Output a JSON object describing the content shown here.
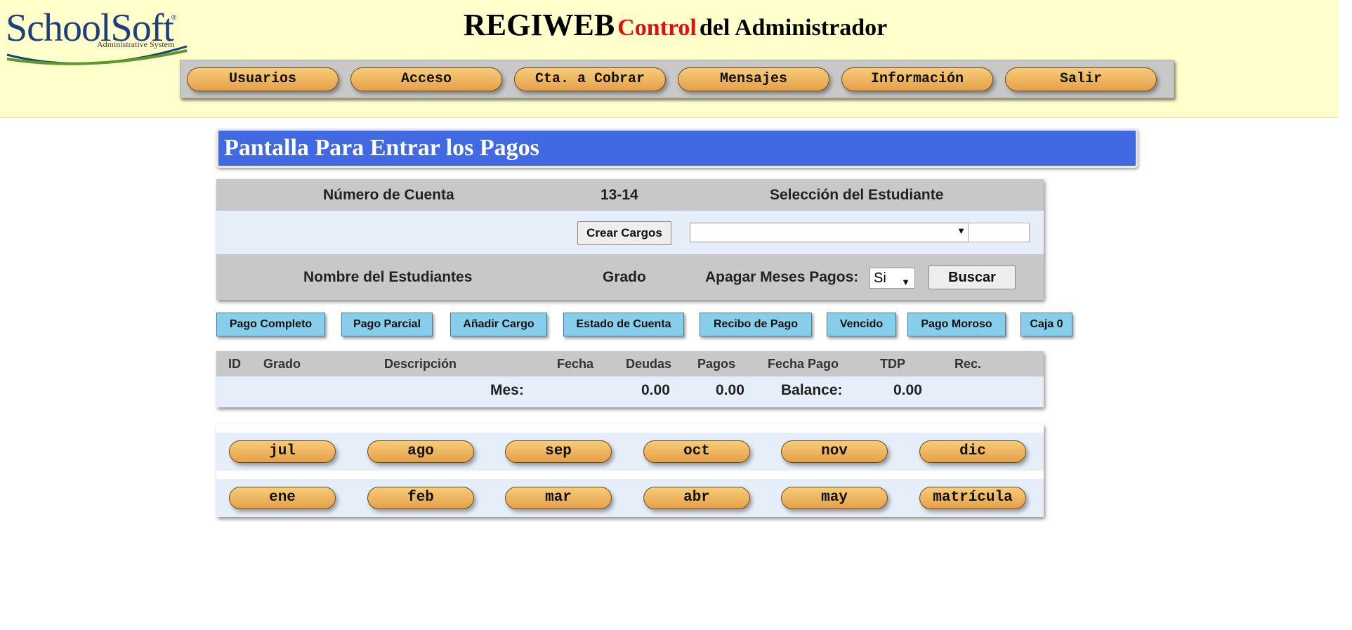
{
  "app": {
    "logo_text": "SchoolSoft",
    "logo_subtitle": "Administrative System",
    "title_part1": "REGIWEB",
    "title_part2": "Control",
    "title_part3": "del Administrador"
  },
  "menu": [
    "Usuarios",
    "Acceso",
    "Cta. a Cobrar",
    "Mensajes",
    "Información",
    "Salir"
  ],
  "page_title": "Pantalla Para Entrar los Pagos",
  "form": {
    "account_label": "Número de Cuenta",
    "year": "13-14",
    "student_select_label": "Selección del Estudiante",
    "create_charges": "Crear Cargos",
    "student_select_value": "",
    "student_input_value": "",
    "student_name_label": "Nombre del Estudiantes",
    "grade_label": "Grado",
    "turn_off_label": "Apagar Meses Pagos:",
    "turn_off_value": "Si",
    "search_button": "Buscar"
  },
  "actions": [
    "Pago Completo",
    "Pago Parcial",
    "Añadir Cargo",
    "Estado de Cuenta",
    "Recibo de Pago",
    "Vencido",
    "Pago Moroso",
    "Caja 0"
  ],
  "table": {
    "headers": [
      "ID",
      "Grado",
      "Descripción",
      "Fecha",
      "Deudas",
      "Pagos",
      "Fecha Pago",
      "TDP",
      "Rec."
    ],
    "totals": {
      "month_label": "Mes:",
      "debts": "0.00",
      "payments": "0.00",
      "balance_label": "Balance:",
      "balance": "0.00"
    }
  },
  "months_row1": [
    "jul",
    "ago",
    "sep",
    "oct",
    "nov",
    "dic"
  ],
  "months_row2": [
    "ene",
    "feb",
    "mar",
    "abr",
    "may",
    "matrícula"
  ],
  "colors": {
    "page_bg": "#ffffcc",
    "title_bar": "#4169e1",
    "accent_red": "#e01010",
    "pill": "#f0b860",
    "action_button": "#87ceeb"
  }
}
